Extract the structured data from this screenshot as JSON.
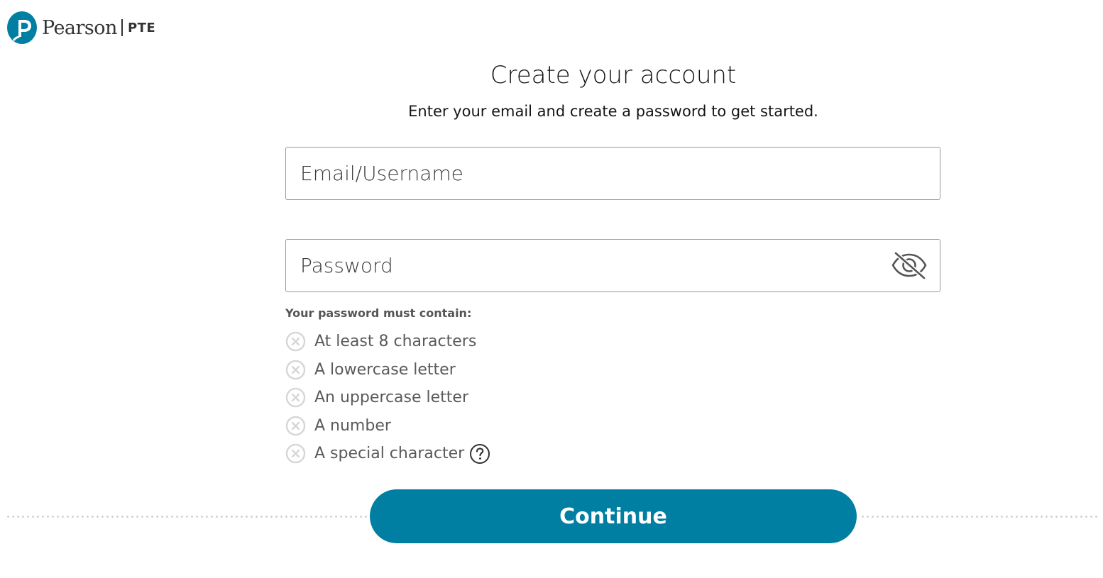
{
  "brand": {
    "name": "Pearson",
    "product": "PTE",
    "accent_color": "#007fa3"
  },
  "heading": {
    "title": "Create your account",
    "subtitle": "Enter your email and create a password to get started."
  },
  "form": {
    "email": {
      "placeholder": "Email/Username",
      "value": ""
    },
    "password": {
      "placeholder": "Password",
      "value": "",
      "toggle_icon": "eye-slash-icon"
    },
    "requirements_heading": "Your password must contain:",
    "requirements": [
      {
        "label": "At least 8 characters",
        "met": false
      },
      {
        "label": "A lowercase letter",
        "met": false
      },
      {
        "label": "An uppercase letter",
        "met": false
      },
      {
        "label": "A number",
        "met": false
      },
      {
        "label": "A special character",
        "met": false,
        "help_icon": "question-circle-icon"
      }
    ],
    "continue_label": "Continue"
  }
}
